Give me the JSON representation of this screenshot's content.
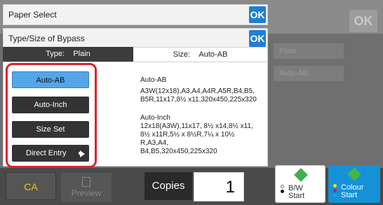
{
  "header": {
    "title": "Paper Select",
    "ok_label": "OK"
  },
  "subheader": {
    "title": "Type/Size of Bypass",
    "ok_label": "OK"
  },
  "background": {
    "ok_label": "OK",
    "row1": "Plain",
    "row2": "Auto-AB"
  },
  "tabs": {
    "type_prefix": "Type:",
    "type_value": "Plain",
    "size_prefix": "Size:",
    "size_value": "Auto-AB"
  },
  "options": {
    "auto_ab": "Auto-AB",
    "auto_inch": "Auto-Inch",
    "size_set": "Size Set",
    "direct_entry": "Direct Entry",
    "selected": "auto_ab"
  },
  "descriptions": {
    "ab_title": "Auto-AB",
    "ab_body": "A3W(12x18),A3,A4,A4R,A5R,B4,B5,\nB5R,11x17,8½ x11,320x450,225x320",
    "inch_title": "Auto-Inch",
    "inch_body": "12x18(A3W),11x17, 8½ x14,8½ x11,\n8½ x11R,5½ x 8½R,7¼ x 10½ R,A3,A4,\nB4,B5,320x450,225x320"
  },
  "bottom": {
    "ca_label": "CA",
    "preview_label": "Preview",
    "copies_label": "Copies",
    "copies_value": "1",
    "bw_label": "B/W",
    "bw_sub": "Start",
    "colour_label": "Colour",
    "colour_sub": "Start"
  },
  "colors": {
    "accent_blue": "#1f7ed6",
    "highlight_red": "#e0202b",
    "selected_option": "#55a6e8",
    "ca_yellow": "#f5c400",
    "start_green": "#3fae49",
    "colour_button": "#1591d8"
  }
}
